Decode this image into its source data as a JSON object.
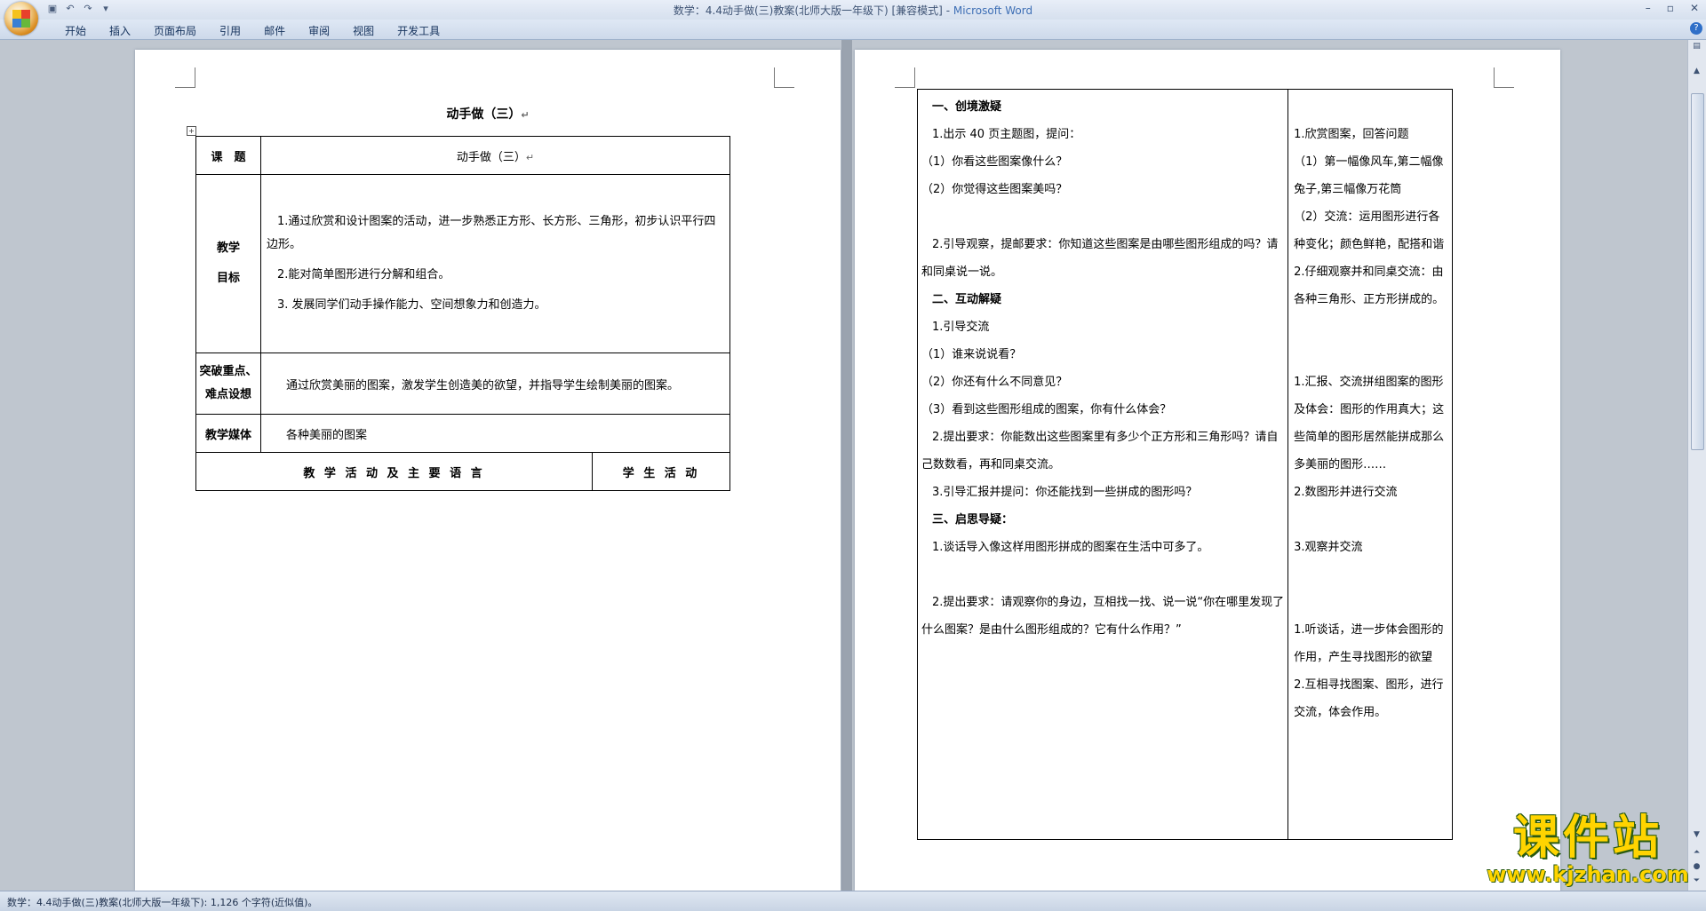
{
  "app": {
    "doc_name": "数学：4.4动手做(三)教案(北师大版一年级下) [兼容模式]",
    "separator": " - ",
    "app_name": "Microsoft Word",
    "ribbon_tabs": [
      "开始",
      "插入",
      "页面布局",
      "引用",
      "邮件",
      "审阅",
      "视图",
      "开发工具"
    ],
    "status": "数学：4.4动手做(三)教案(北师大版一年级下): 1,126 个字符(近似值)。",
    "help_glyph": "?"
  },
  "left_page": {
    "heading": "动手做（三）",
    "table": {
      "topic_label": "课　题",
      "topic_value": "动手做（三）",
      "goals_label_1": "教学",
      "goals_label_2": "目标",
      "goals": [
        "1.通过欣赏和设计图案的活动，进一步熟悉正方形、长方形、三角形，初步认识平行四边形。",
        "2.能对简单图形进行分解和组合。",
        "3. 发展同学们动手操作能力、空间想象力和创造力。"
      ],
      "key_label_1": "突破重点、",
      "key_label_2": "难点设想",
      "key_value": "通过欣赏美丽的图案，激发学生创造美的欲望，并指导学生绘制美丽的图案。",
      "media_label": "教学媒体",
      "media_value": "各种美丽的图案",
      "activity_header": "教 学 活 动 及 主 要 语 言",
      "student_header": "学 生 活 动"
    }
  },
  "right_page": {
    "teacher": [
      {
        "text": "一、创境激疑",
        "bold": true
      },
      {
        "text": "1.出示 40 页主题图，提问：",
        "bold": false
      },
      {
        "text": "（1）你看这些图案像什么？",
        "bold": false
      },
      {
        "text": "（2）你觉得这些图案美吗？",
        "bold": false
      },
      {
        "text": "",
        "bold": false
      },
      {
        "text": "2.引导观察，提邮要求：你知道这些图案是由哪些图形组成的吗？请和同桌说一说。",
        "bold": false,
        "wrap": true
      },
      {
        "text": "二、互动解疑",
        "bold": true
      },
      {
        "text": "1.引导交流",
        "bold": false
      },
      {
        "text": "（1）谁来说说看？",
        "bold": false
      },
      {
        "text": "（2）你还有什么不同意见？",
        "bold": false
      },
      {
        "text": "（3）看到这些图形组成的图案，你有什么体会？",
        "bold": false
      },
      {
        "text": "2.提出要求：你能数出这些图案里有多少个正方形和三角形吗？请自己数数看，再和同桌交流。",
        "bold": false,
        "wrap": true
      },
      {
        "text": "3.引导汇报并提问：你还能找到一些拼成的图形吗？",
        "bold": false
      },
      {
        "text": "三、启思导疑：",
        "bold": true
      },
      {
        "text": "1.谈话导入像这样用图形拼成的图案在生活中可多了。",
        "bold": false
      },
      {
        "text": "",
        "bold": false
      },
      {
        "text": "2.提出要求：请观察你的身边，互相找一找、说一说“你在哪里发现了什么图案？是由什么图形组成的？它有什么作用？”",
        "bold": false,
        "wrap": true
      }
    ],
    "student": [
      "",
      "1.欣赏图案，回答问题",
      "（1）第一幅像风车,第二幅像兔子,第三幅像万花筒",
      "（2）交流：运用图形进行各种变化；颜色鲜艳，配搭和谐",
      "2.仔细观察并和同桌交流：由各种三角形、正方形拼成的。",
      "",
      "",
      "1.汇报、交流拼组图案的图形及体会：图形的作用真大；这些简单的图形居然能拼成那么多美丽的图形……",
      "2.数图形并进行交流",
      "",
      "3.观察并交流",
      "",
      "",
      "1.听谈话，进一步体会图形的作用，产生寻找图形的欲望",
      "2.互相寻找图案、图形，进行交流，体会作用。"
    ]
  },
  "watermark": {
    "line1": "课件站",
    "line2": "www.kjzhan.com"
  }
}
